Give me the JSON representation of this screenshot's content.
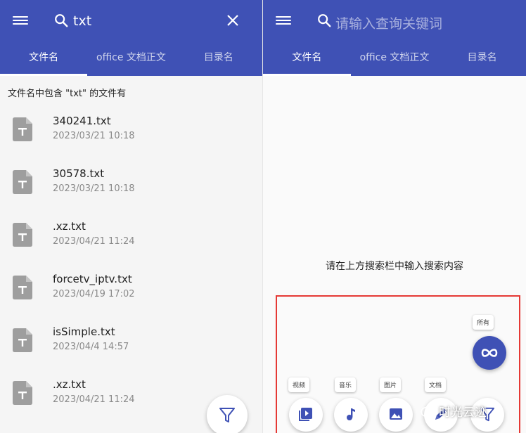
{
  "left": {
    "search_query": "txt",
    "tabs": [
      {
        "label": "文件名",
        "active": true
      },
      {
        "label": "office 文档正文",
        "active": false
      },
      {
        "label": "目录名",
        "active": false
      }
    ],
    "result_header": "文件名中包含 \"txt\" 的文件有",
    "files": [
      {
        "name": "340241.txt",
        "date": "2023/03/21  10:18"
      },
      {
        "name": "30578.txt",
        "date": "2023/03/21  10:18"
      },
      {
        "name": ".xz.txt",
        "date": "2023/04/21  11:24"
      },
      {
        "name": "forcetv_iptv.txt",
        "date": "2023/04/19  17:02"
      },
      {
        "name": "isSimple.txt",
        "date": "2023/04/4  14:57"
      },
      {
        "name": ".xz.txt",
        "date": "2023/04/21  11:24"
      }
    ]
  },
  "right": {
    "search_placeholder": "请输入查询关键词",
    "tabs": [
      {
        "label": "文件名",
        "active": true
      },
      {
        "label": "office 文档正文",
        "active": false
      },
      {
        "label": "目录名",
        "active": false
      }
    ],
    "empty_hint": "请在上方搜索栏中输入搜索内容",
    "filter_all_label": "所有",
    "type_filters": [
      {
        "label": "视频",
        "icon": "video-library-icon"
      },
      {
        "label": "音乐",
        "icon": "music-note-icon"
      },
      {
        "label": "图片",
        "icon": "image-icon"
      },
      {
        "label": "文档",
        "icon": "document-edit-icon"
      }
    ]
  },
  "watermark": "时光云迹",
  "colors": {
    "app_bar": "#3f51b5",
    "highlight": "#e53935",
    "file_icon": "#9e9e9e"
  }
}
